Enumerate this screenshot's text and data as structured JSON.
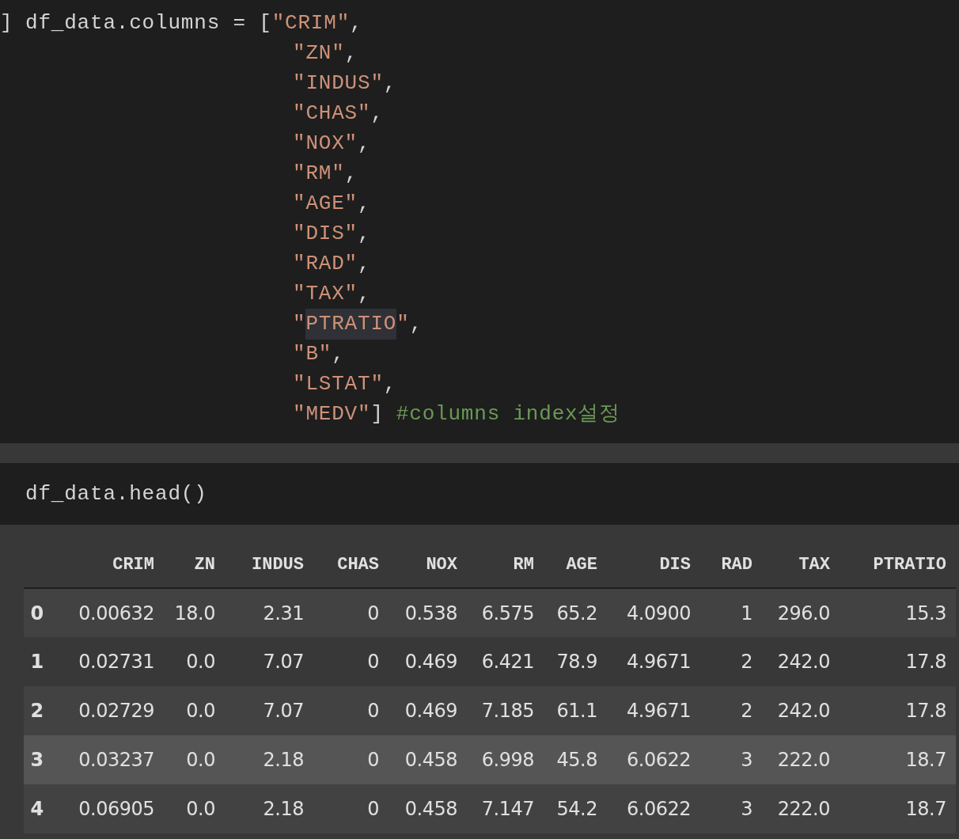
{
  "code_cell": {
    "prompt": "]",
    "lines": [
      [
        {
          "kind": "plain",
          "text": "df_data.columns = ["
        },
        {
          "kind": "string",
          "text": "\"CRIM\""
        },
        {
          "kind": "plain",
          "text": ","
        }
      ],
      [
        {
          "kind": "string",
          "text": "\"ZN\""
        },
        {
          "kind": "plain",
          "text": ","
        }
      ],
      [
        {
          "kind": "string",
          "text": "\"INDUS\""
        },
        {
          "kind": "plain",
          "text": ","
        }
      ],
      [
        {
          "kind": "string",
          "text": "\"CHAS\""
        },
        {
          "kind": "plain",
          "text": ","
        }
      ],
      [
        {
          "kind": "string",
          "text": "\"NOX\""
        },
        {
          "kind": "plain",
          "text": ","
        }
      ],
      [
        {
          "kind": "string",
          "text": "\"RM\""
        },
        {
          "kind": "plain",
          "text": ","
        }
      ],
      [
        {
          "kind": "string",
          "text": "\"AGE\""
        },
        {
          "kind": "plain",
          "text": ","
        }
      ],
      [
        {
          "kind": "string",
          "text": "\"DIS\""
        },
        {
          "kind": "plain",
          "text": ","
        }
      ],
      [
        {
          "kind": "string",
          "text": "\"RAD\""
        },
        {
          "kind": "plain",
          "text": ","
        }
      ],
      [
        {
          "kind": "string",
          "text": "\"TAX\""
        },
        {
          "kind": "plain",
          "text": ","
        }
      ],
      [
        {
          "kind": "string",
          "text": "\""
        },
        {
          "kind": "string",
          "text": "PTRATIO",
          "highlighted": true
        },
        {
          "kind": "string",
          "text": "\""
        },
        {
          "kind": "plain",
          "text": ","
        }
      ],
      [
        {
          "kind": "string",
          "text": "\"B\""
        },
        {
          "kind": "plain",
          "text": ","
        }
      ],
      [
        {
          "kind": "string",
          "text": "\"LSTAT\""
        },
        {
          "kind": "plain",
          "text": ","
        }
      ],
      [
        {
          "kind": "string",
          "text": "\"MEDV\""
        },
        {
          "kind": "plain",
          "text": "]"
        },
        {
          "kind": "comment",
          "text": "#columns index설정"
        }
      ]
    ]
  },
  "second_cell": {
    "code": "df_data.head()"
  },
  "table": {
    "columns": [
      "",
      "CRIM",
      "ZN",
      "INDUS",
      "CHAS",
      "NOX",
      "RM",
      "AGE",
      "DIS",
      "RAD",
      "TAX",
      "PTRATIO"
    ],
    "rows": [
      {
        "selected": false,
        "cells": [
          "0",
          "0.00632",
          "18.0",
          "2.31",
          "0",
          "0.538",
          "6.575",
          "65.2",
          "4.0900",
          "1",
          "296.0",
          "15.3"
        ]
      },
      {
        "selected": false,
        "cells": [
          "1",
          "0.02731",
          "0.0",
          "7.07",
          "0",
          "0.469",
          "6.421",
          "78.9",
          "4.9671",
          "2",
          "242.0",
          "17.8"
        ]
      },
      {
        "selected": false,
        "cells": [
          "2",
          "0.02729",
          "0.0",
          "7.07",
          "0",
          "0.469",
          "7.185",
          "61.1",
          "4.9671",
          "2",
          "242.0",
          "17.8"
        ]
      },
      {
        "selected": true,
        "cells": [
          "3",
          "0.03237",
          "0.0",
          "2.18",
          "0",
          "0.458",
          "6.998",
          "45.8",
          "6.0622",
          "3",
          "222.0",
          "18.7"
        ]
      },
      {
        "selected": false,
        "cells": [
          "4",
          "0.06905",
          "0.0",
          "2.18",
          "0",
          "0.458",
          "7.147",
          "54.2",
          "6.0622",
          "3",
          "222.0",
          "18.7"
        ]
      }
    ]
  }
}
